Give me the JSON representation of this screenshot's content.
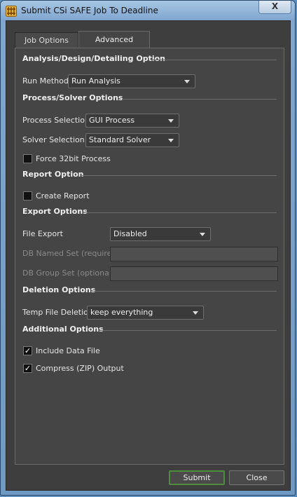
{
  "window": {
    "title": "Submit CSi SAFE Job To Deadline",
    "close_glyph": "X"
  },
  "tabs": [
    {
      "label": "Job Options",
      "active": false
    },
    {
      "label": "Advanced Options",
      "active": true
    }
  ],
  "sections": {
    "analysis": "Analysis/Design/Detailing Option",
    "process": "Process/Solver Options",
    "report": "Report Option",
    "export": "Export Options",
    "deletion": "Deletion Options",
    "additional": "Additional Options"
  },
  "run_method": {
    "label": "Run Method",
    "value": "Run Analysis"
  },
  "process_selection": {
    "label": "Process Selection",
    "value": "GUI Process"
  },
  "solver_selection": {
    "label": "Solver Selection",
    "value": "Standard Solver"
  },
  "force32": {
    "label": "Force 32bit Process",
    "checked": false
  },
  "create_report": {
    "label": "Create Report",
    "checked": false
  },
  "file_export": {
    "label": "File Export",
    "value": "Disabled"
  },
  "db_named_set": {
    "label": "DB Named Set (required)",
    "value": ""
  },
  "db_group_set": {
    "label": "DB Group Set (optional)",
    "value": ""
  },
  "temp_file_deletion": {
    "label": "Temp File Deletion",
    "value": "keep everything"
  },
  "include_data_file": {
    "label": "Include Data File",
    "checked": true,
    "glyph": "✓"
  },
  "compress_output": {
    "label": "Compress (ZIP) Output",
    "checked": true,
    "glyph": "✓"
  },
  "buttons": {
    "submit": "Submit",
    "close": "Close"
  },
  "colors": {
    "accent_default_button": "#4f8d3e",
    "panel_bg": "#454545"
  }
}
